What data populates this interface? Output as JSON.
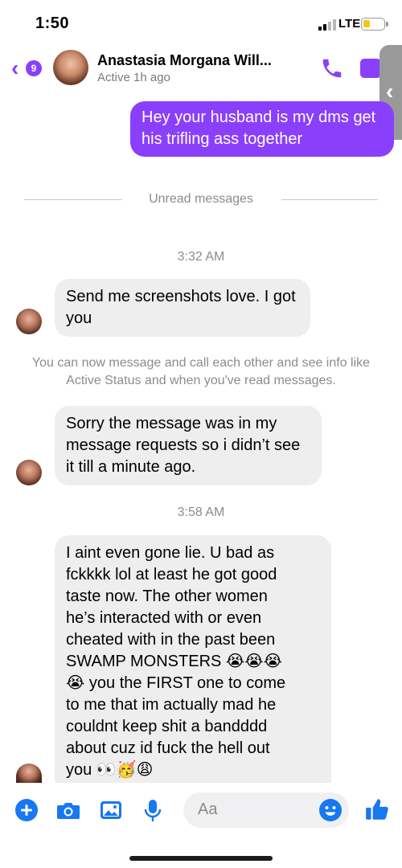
{
  "status_bar": {
    "time": "1:50",
    "network": "LTE",
    "battery_level": 0.25,
    "signal_bars": 2
  },
  "header": {
    "back_count": "9",
    "contact_name": "Anastasia Morgana Will...",
    "contact_status": "Active 1h ago"
  },
  "messages": {
    "outgoing_1": "Hey your husband is my dms get his trifling ass together",
    "unread_divider": "Unread messages",
    "time_1": "3:32 AM",
    "incoming_1": "Send me screenshots love. I got you",
    "notice": "You can now message and call each other and see info like Active Status and when you've read messages.",
    "incoming_2": "Sorry the message was in my message requests so i didn’t see it till a minute ago.",
    "time_2": "3:58 AM",
    "incoming_3_lines": [
      "I aint even gone lie. U bad as",
      "fckkkk lol at least he got good",
      "taste now. The other women",
      "he’s interacted with or even",
      "cheated with in the past been",
      "SWAMP MONSTERS 😭😭😭",
      "😭 you the FIRST one to come",
      "to me that im actually mad he",
      "couldnt keep shit a bandddd",
      "about cuz id fuck the hell out",
      "you 👀🥳😩"
    ]
  },
  "composer": {
    "placeholder": "Aa"
  },
  "colors": {
    "accent": "#8a3ffc",
    "composer_blue": "#1877f2",
    "incoming_bubble": "#eeeeef",
    "muted_text": "#8c8c8c"
  },
  "icons": [
    "chevron-left-icon",
    "phone-icon",
    "video-icon",
    "plus-icon",
    "camera-icon",
    "image-icon",
    "microphone-icon",
    "emoji-icon",
    "thumbs-up-icon"
  ]
}
